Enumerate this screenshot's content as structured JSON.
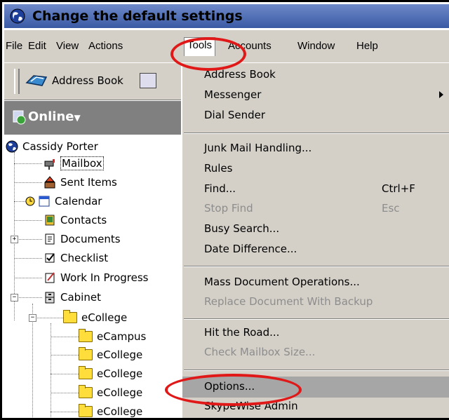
{
  "window": {
    "title": "Change the default settings"
  },
  "menubar": {
    "items": [
      {
        "label": "File"
      },
      {
        "label": "Edit"
      },
      {
        "label": "View"
      },
      {
        "label": "Actions"
      },
      {
        "label": "Tools"
      },
      {
        "label": "Accounts"
      },
      {
        "label": "Window"
      },
      {
        "label": "Help"
      }
    ]
  },
  "toolbar": {
    "address_book_label": "Address Book"
  },
  "online": {
    "label": "Online"
  },
  "tree": {
    "root": "Cassidy Porter",
    "items": [
      {
        "label": "Mailbox"
      },
      {
        "label": "Sent Items"
      },
      {
        "label": "Calendar"
      },
      {
        "label": "Contacts"
      },
      {
        "label": "Documents"
      },
      {
        "label": "Checklist"
      },
      {
        "label": "Work In Progress"
      },
      {
        "label": "Cabinet"
      },
      {
        "label": "eCollege"
      },
      {
        "label": "eCampus"
      },
      {
        "label": "eCollege"
      },
      {
        "label": "eCollege"
      },
      {
        "label": "eCollege"
      },
      {
        "label": "eCollege"
      }
    ]
  },
  "tools_menu": {
    "items": [
      {
        "label": "Address Book"
      },
      {
        "label": "Messenger"
      },
      {
        "label": "Dial Sender"
      },
      {
        "label": "Junk Mail Handling..."
      },
      {
        "label": "Rules"
      },
      {
        "label": "Find...",
        "shortcut": "Ctrl+F"
      },
      {
        "label": "Stop Find",
        "shortcut": "Esc"
      },
      {
        "label": "Busy Search..."
      },
      {
        "label": "Date Difference..."
      },
      {
        "label": "Mass Document Operations..."
      },
      {
        "label": "Replace Document With Backup"
      },
      {
        "label": "Hit the Road..."
      },
      {
        "label": "Check Mailbox Size..."
      },
      {
        "label": "Options..."
      },
      {
        "label": "SkypeWise Admin"
      }
    ]
  },
  "colors": {
    "highlight_oval": "#e01818",
    "menu_bg": "#d4d0c8",
    "title_bg": "#3a5aa4"
  }
}
